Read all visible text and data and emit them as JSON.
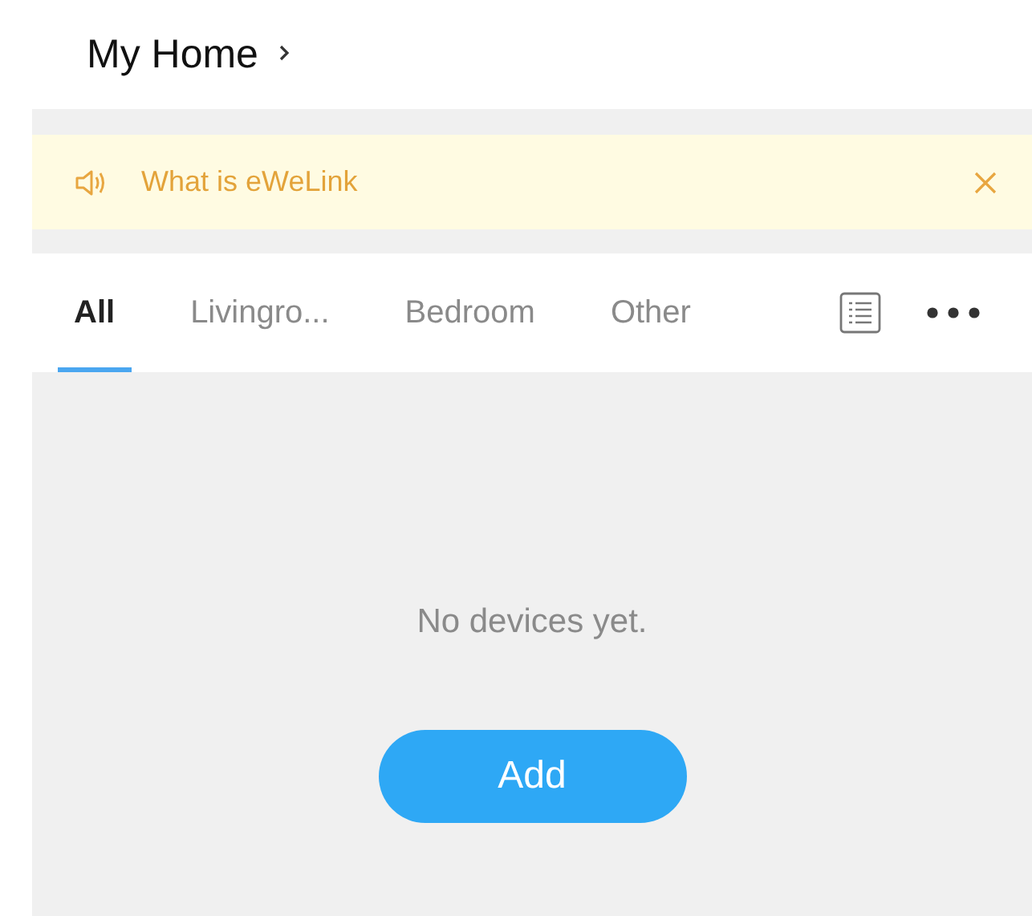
{
  "header": {
    "title": "My Home"
  },
  "banner": {
    "text": "What is eWeLink"
  },
  "tabs": [
    {
      "label": "All",
      "selected": true
    },
    {
      "label": "Livingro...",
      "selected": false
    },
    {
      "label": "Bedroom",
      "selected": false
    },
    {
      "label": "Other",
      "selected": false
    }
  ],
  "empty_state": {
    "message": "No devices yet.",
    "button": "Add"
  }
}
